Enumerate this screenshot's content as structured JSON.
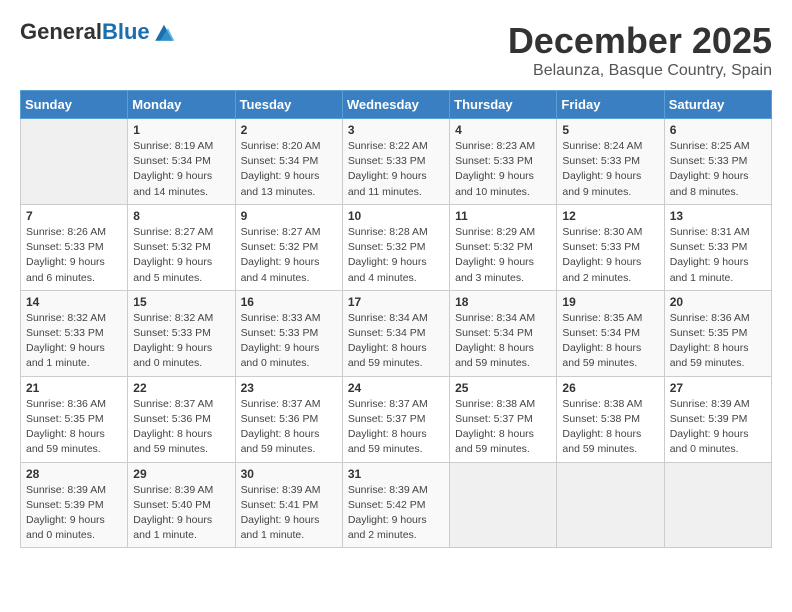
{
  "logo": {
    "general": "General",
    "blue": "Blue"
  },
  "title": "December 2025",
  "subtitle": "Belaunza, Basque Country, Spain",
  "days_of_week": [
    "Sunday",
    "Monday",
    "Tuesday",
    "Wednesday",
    "Thursday",
    "Friday",
    "Saturday"
  ],
  "weeks": [
    [
      {
        "day": "",
        "sunrise": "",
        "sunset": "",
        "daylight": ""
      },
      {
        "day": "1",
        "sunrise": "Sunrise: 8:19 AM",
        "sunset": "Sunset: 5:34 PM",
        "daylight": "Daylight: 9 hours and 14 minutes."
      },
      {
        "day": "2",
        "sunrise": "Sunrise: 8:20 AM",
        "sunset": "Sunset: 5:34 PM",
        "daylight": "Daylight: 9 hours and 13 minutes."
      },
      {
        "day": "3",
        "sunrise": "Sunrise: 8:22 AM",
        "sunset": "Sunset: 5:33 PM",
        "daylight": "Daylight: 9 hours and 11 minutes."
      },
      {
        "day": "4",
        "sunrise": "Sunrise: 8:23 AM",
        "sunset": "Sunset: 5:33 PM",
        "daylight": "Daylight: 9 hours and 10 minutes."
      },
      {
        "day": "5",
        "sunrise": "Sunrise: 8:24 AM",
        "sunset": "Sunset: 5:33 PM",
        "daylight": "Daylight: 9 hours and 9 minutes."
      },
      {
        "day": "6",
        "sunrise": "Sunrise: 8:25 AM",
        "sunset": "Sunset: 5:33 PM",
        "daylight": "Daylight: 9 hours and 8 minutes."
      }
    ],
    [
      {
        "day": "7",
        "sunrise": "Sunrise: 8:26 AM",
        "sunset": "Sunset: 5:33 PM",
        "daylight": "Daylight: 9 hours and 6 minutes."
      },
      {
        "day": "8",
        "sunrise": "Sunrise: 8:27 AM",
        "sunset": "Sunset: 5:32 PM",
        "daylight": "Daylight: 9 hours and 5 minutes."
      },
      {
        "day": "9",
        "sunrise": "Sunrise: 8:27 AM",
        "sunset": "Sunset: 5:32 PM",
        "daylight": "Daylight: 9 hours and 4 minutes."
      },
      {
        "day": "10",
        "sunrise": "Sunrise: 8:28 AM",
        "sunset": "Sunset: 5:32 PM",
        "daylight": "Daylight: 9 hours and 4 minutes."
      },
      {
        "day": "11",
        "sunrise": "Sunrise: 8:29 AM",
        "sunset": "Sunset: 5:32 PM",
        "daylight": "Daylight: 9 hours and 3 minutes."
      },
      {
        "day": "12",
        "sunrise": "Sunrise: 8:30 AM",
        "sunset": "Sunset: 5:33 PM",
        "daylight": "Daylight: 9 hours and 2 minutes."
      },
      {
        "day": "13",
        "sunrise": "Sunrise: 8:31 AM",
        "sunset": "Sunset: 5:33 PM",
        "daylight": "Daylight: 9 hours and 1 minute."
      }
    ],
    [
      {
        "day": "14",
        "sunrise": "Sunrise: 8:32 AM",
        "sunset": "Sunset: 5:33 PM",
        "daylight": "Daylight: 9 hours and 1 minute."
      },
      {
        "day": "15",
        "sunrise": "Sunrise: 8:32 AM",
        "sunset": "Sunset: 5:33 PM",
        "daylight": "Daylight: 9 hours and 0 minutes."
      },
      {
        "day": "16",
        "sunrise": "Sunrise: 8:33 AM",
        "sunset": "Sunset: 5:33 PM",
        "daylight": "Daylight: 9 hours and 0 minutes."
      },
      {
        "day": "17",
        "sunrise": "Sunrise: 8:34 AM",
        "sunset": "Sunset: 5:34 PM",
        "daylight": "Daylight: 8 hours and 59 minutes."
      },
      {
        "day": "18",
        "sunrise": "Sunrise: 8:34 AM",
        "sunset": "Sunset: 5:34 PM",
        "daylight": "Daylight: 8 hours and 59 minutes."
      },
      {
        "day": "19",
        "sunrise": "Sunrise: 8:35 AM",
        "sunset": "Sunset: 5:34 PM",
        "daylight": "Daylight: 8 hours and 59 minutes."
      },
      {
        "day": "20",
        "sunrise": "Sunrise: 8:36 AM",
        "sunset": "Sunset: 5:35 PM",
        "daylight": "Daylight: 8 hours and 59 minutes."
      }
    ],
    [
      {
        "day": "21",
        "sunrise": "Sunrise: 8:36 AM",
        "sunset": "Sunset: 5:35 PM",
        "daylight": "Daylight: 8 hours and 59 minutes."
      },
      {
        "day": "22",
        "sunrise": "Sunrise: 8:37 AM",
        "sunset": "Sunset: 5:36 PM",
        "daylight": "Daylight: 8 hours and 59 minutes."
      },
      {
        "day": "23",
        "sunrise": "Sunrise: 8:37 AM",
        "sunset": "Sunset: 5:36 PM",
        "daylight": "Daylight: 8 hours and 59 minutes."
      },
      {
        "day": "24",
        "sunrise": "Sunrise: 8:37 AM",
        "sunset": "Sunset: 5:37 PM",
        "daylight": "Daylight: 8 hours and 59 minutes."
      },
      {
        "day": "25",
        "sunrise": "Sunrise: 8:38 AM",
        "sunset": "Sunset: 5:37 PM",
        "daylight": "Daylight: 8 hours and 59 minutes."
      },
      {
        "day": "26",
        "sunrise": "Sunrise: 8:38 AM",
        "sunset": "Sunset: 5:38 PM",
        "daylight": "Daylight: 8 hours and 59 minutes."
      },
      {
        "day": "27",
        "sunrise": "Sunrise: 8:39 AM",
        "sunset": "Sunset: 5:39 PM",
        "daylight": "Daylight: 9 hours and 0 minutes."
      }
    ],
    [
      {
        "day": "28",
        "sunrise": "Sunrise: 8:39 AM",
        "sunset": "Sunset: 5:39 PM",
        "daylight": "Daylight: 9 hours and 0 minutes."
      },
      {
        "day": "29",
        "sunrise": "Sunrise: 8:39 AM",
        "sunset": "Sunset: 5:40 PM",
        "daylight": "Daylight: 9 hours and 1 minute."
      },
      {
        "day": "30",
        "sunrise": "Sunrise: 8:39 AM",
        "sunset": "Sunset: 5:41 PM",
        "daylight": "Daylight: 9 hours and 1 minute."
      },
      {
        "day": "31",
        "sunrise": "Sunrise: 8:39 AM",
        "sunset": "Sunset: 5:42 PM",
        "daylight": "Daylight: 9 hours and 2 minutes."
      },
      {
        "day": "",
        "sunrise": "",
        "sunset": "",
        "daylight": ""
      },
      {
        "day": "",
        "sunrise": "",
        "sunset": "",
        "daylight": ""
      },
      {
        "day": "",
        "sunrise": "",
        "sunset": "",
        "daylight": ""
      }
    ]
  ]
}
